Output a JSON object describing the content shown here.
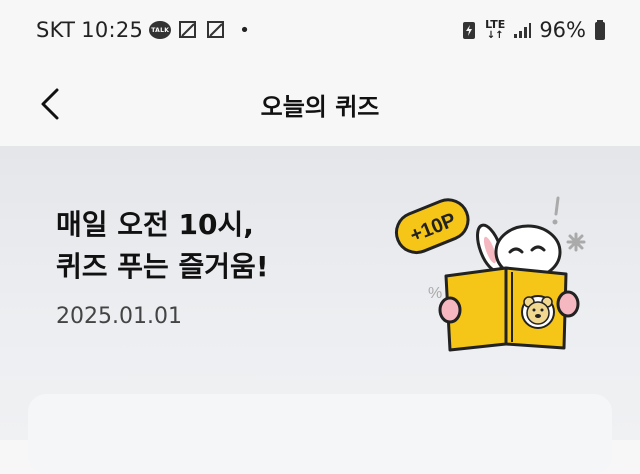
{
  "status_bar": {
    "carrier": "SKT",
    "time": "10:25",
    "talk_badge": "TALK",
    "network": "LTE",
    "battery": "96%"
  },
  "header": {
    "title": "오늘의 퀴즈"
  },
  "banner": {
    "line1": "매일 오전 10시,",
    "line2": "퀴즈 푸는 즐거움!",
    "date": "2025.01.01",
    "badge": "+10P"
  },
  "colors": {
    "background": "#f7f7f7",
    "banner_bg": "#e8eaed",
    "book_yellow": "#f5c518",
    "text_primary": "#111111",
    "text_secondary": "#444444"
  }
}
